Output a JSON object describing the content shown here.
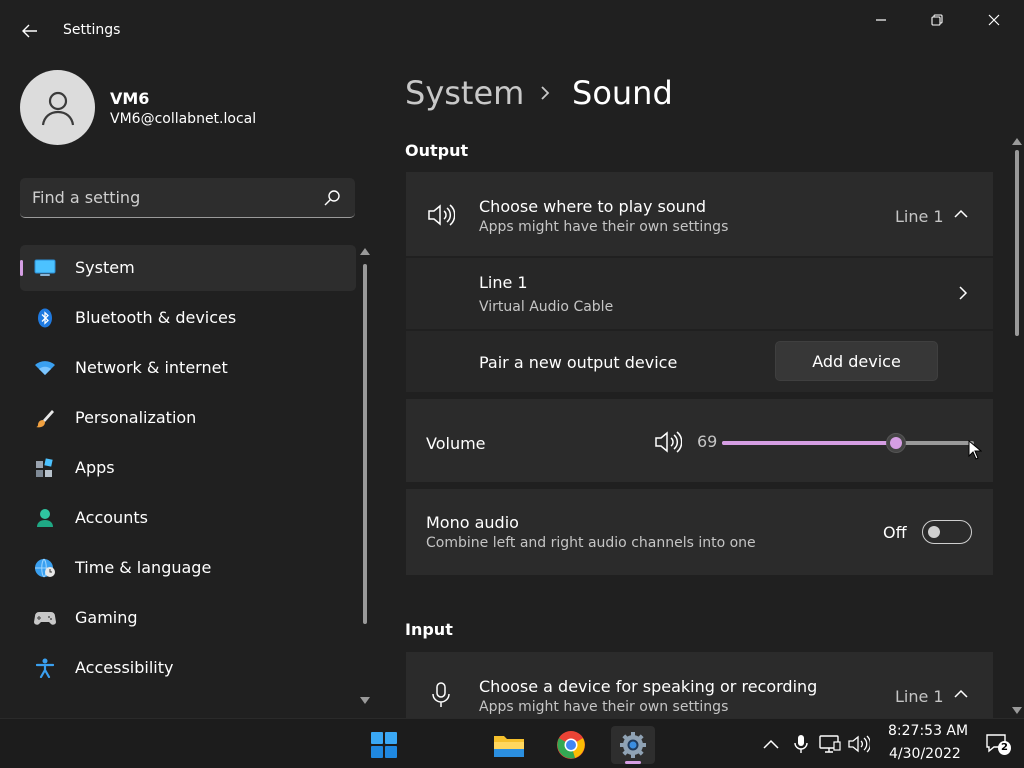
{
  "window": {
    "app_title": "Settings",
    "controls": {
      "minimize": "minimize",
      "maximize": "restore",
      "close": "close"
    }
  },
  "profile": {
    "name": "VM6",
    "email": "VM6@collabnet.local"
  },
  "search": {
    "placeholder": "Find a setting"
  },
  "sidebar": {
    "items": [
      {
        "label": "System",
        "icon": "system-icon",
        "active": true
      },
      {
        "label": "Bluetooth & devices",
        "icon": "bluetooth-icon",
        "active": false
      },
      {
        "label": "Network & internet",
        "icon": "wifi-icon",
        "active": false
      },
      {
        "label": "Personalization",
        "icon": "paintbrush-icon",
        "active": false
      },
      {
        "label": "Apps",
        "icon": "apps-icon",
        "active": false
      },
      {
        "label": "Accounts",
        "icon": "accounts-icon",
        "active": false
      },
      {
        "label": "Time & language",
        "icon": "globe-clock-icon",
        "active": false
      },
      {
        "label": "Gaming",
        "icon": "gamepad-icon",
        "active": false
      },
      {
        "label": "Accessibility",
        "icon": "accessibility-icon",
        "active": false
      }
    ]
  },
  "breadcrumb": {
    "parent": "System",
    "current": "Sound"
  },
  "output": {
    "section_title": "Output",
    "choose": {
      "title": "Choose where to play sound",
      "description": "Apps might have their own settings",
      "value": "Line 1"
    },
    "device": {
      "name": "Line 1",
      "subtitle": "Virtual Audio Cable"
    },
    "pair": {
      "label": "Pair a new output device",
      "button": "Add device"
    },
    "volume": {
      "label": "Volume",
      "value": "69",
      "level_percent": 69
    },
    "mono": {
      "title": "Mono audio",
      "description": "Combine left and right audio channels into one",
      "state": "Off"
    }
  },
  "input": {
    "section_title": "Input",
    "choose": {
      "title": "Choose a device for speaking or recording",
      "description": "Apps might have their own settings",
      "value": "Line 1"
    }
  },
  "taskbar": {
    "apps": [
      "start-icon",
      "file-explorer-icon",
      "chrome-icon",
      "settings-icon"
    ],
    "active_app": "settings-icon",
    "time": "8:27:53 AM",
    "date": "4/30/2022",
    "notification_count": "2"
  },
  "colors": {
    "accent": "#d59ee3",
    "background": "#202020",
    "card": "#2b2b2b"
  }
}
